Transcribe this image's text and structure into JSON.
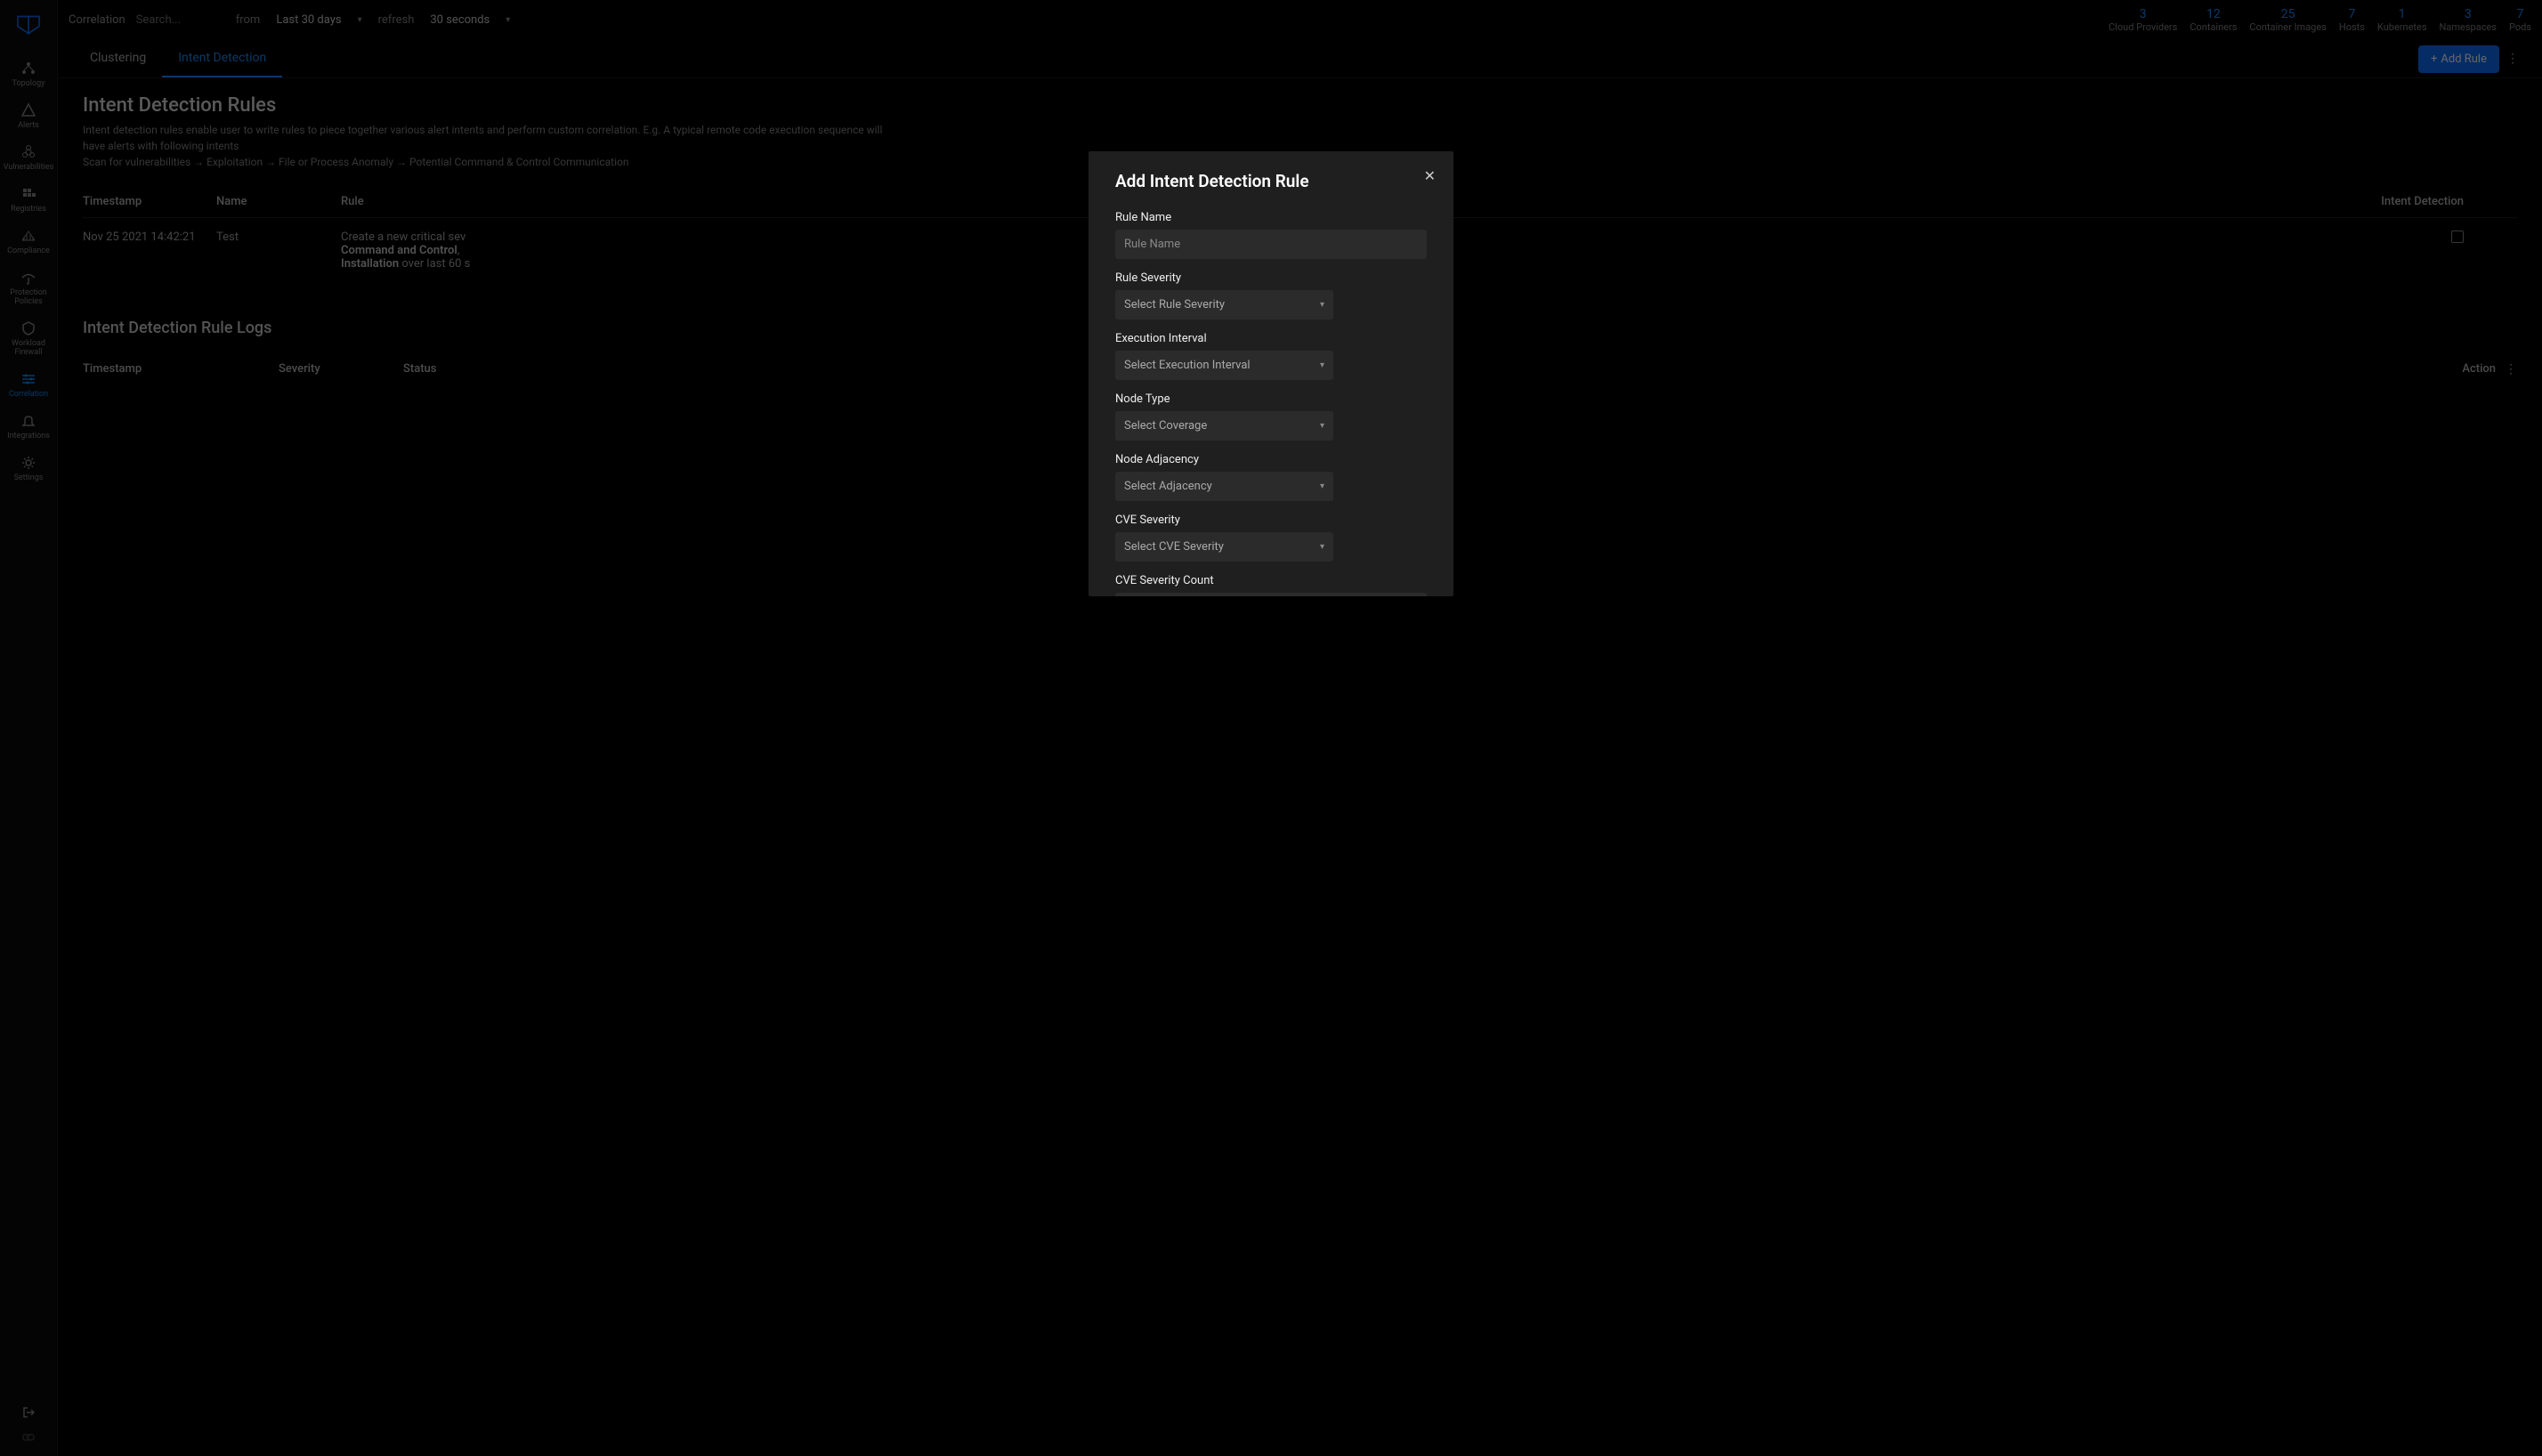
{
  "breadcrumb": "Correlation",
  "search": {
    "placeholder": "Search..."
  },
  "timeframe": {
    "label": "from",
    "value": "Last 30 days"
  },
  "refresh": {
    "label": "refresh",
    "value": "30 seconds"
  },
  "stats": [
    {
      "num": "3",
      "label": "Cloud Providers"
    },
    {
      "num": "12",
      "label": "Containers"
    },
    {
      "num": "25",
      "label": "Container Images"
    },
    {
      "num": "7",
      "label": "Hosts"
    },
    {
      "num": "1",
      "label": "Kubernetes"
    },
    {
      "num": "3",
      "label": "Namespaces"
    },
    {
      "num": "7",
      "label": "Pods"
    }
  ],
  "sidebar": {
    "items": [
      {
        "label": "Topology"
      },
      {
        "label": "Alerts"
      },
      {
        "label": "Vulnerabilities"
      },
      {
        "label": "Registries"
      },
      {
        "label": "Compliance"
      },
      {
        "label": "Protection Policies"
      },
      {
        "label": "Workload Firewall"
      },
      {
        "label": "Correlation"
      },
      {
        "label": "Integrations"
      },
      {
        "label": "Settings"
      }
    ]
  },
  "tabs": {
    "clustering": "Clustering",
    "intent": "Intent Detection"
  },
  "add_rule_btn": "Add Rule",
  "page": {
    "title": "Intent Detection Rules",
    "desc_line1": "Intent detection rules enable user to write rules to piece together various alert intents and perform custom correlation. E.g. A typical remote code execution sequence will have alerts with following intents",
    "desc_line2": "Scan for vulnerabilities → Exploitation → File or Process Anomaly → Potential Command & Control Communication"
  },
  "rules_table": {
    "headers": {
      "ts": "Timestamp",
      "name": "Name",
      "rule": "Rule",
      "intent": "Intent Detection"
    },
    "rows": [
      {
        "ts": "Nov 25 2021 14:42:21",
        "name": "Test",
        "rule_prefix": "Create a new critical sev",
        "rule_b1": "Command and Control",
        "rule_mid": ", ",
        "rule_b2": "Installation",
        "rule_suffix": " over last 60 s"
      }
    ]
  },
  "logs": {
    "title": "Intent Detection Rule Logs",
    "headers": {
      "ts": "Timestamp",
      "sev": "Severity",
      "status": "Status",
      "action": "Action"
    }
  },
  "modal": {
    "title": "Add Intent Detection Rule",
    "fields": {
      "rule_name": {
        "label": "Rule Name",
        "placeholder": "Rule Name"
      },
      "rule_severity": {
        "label": "Rule Severity",
        "placeholder": "Select Rule Severity"
      },
      "exec_interval": {
        "label": "Execution Interval",
        "placeholder": "Select Execution Interval"
      },
      "node_type": {
        "label": "Node Type",
        "placeholder": "Select Coverage"
      },
      "node_adj": {
        "label": "Node Adjacency",
        "placeholder": "Select Adjacency"
      },
      "cve_sev": {
        "label": "CVE Severity",
        "placeholder": "Select CVE Severity"
      },
      "cve_count": {
        "label": "CVE Severity Count",
        "placeholder": "CVE Severity Count"
      }
    }
  }
}
